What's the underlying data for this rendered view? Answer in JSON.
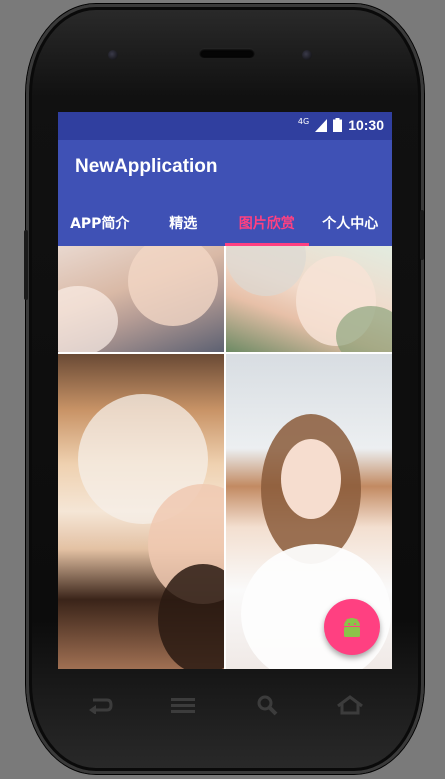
{
  "status_bar": {
    "network": "4G",
    "time": "10:30"
  },
  "app_bar": {
    "title": "NewApplication"
  },
  "tabs": [
    {
      "label": "APP简介",
      "active": false
    },
    {
      "label": "精选",
      "active": false
    },
    {
      "label": "图片欣赏",
      "active": true
    },
    {
      "label": "个人中心",
      "active": false
    }
  ],
  "colors": {
    "primary": "#3f51b5",
    "primary_dark": "#303f9f",
    "accent": "#ff4081"
  },
  "fab": {
    "icon": "android-icon"
  },
  "nav_buttons": [
    "back-icon",
    "menu-icon",
    "search-icon",
    "home-icon"
  ]
}
